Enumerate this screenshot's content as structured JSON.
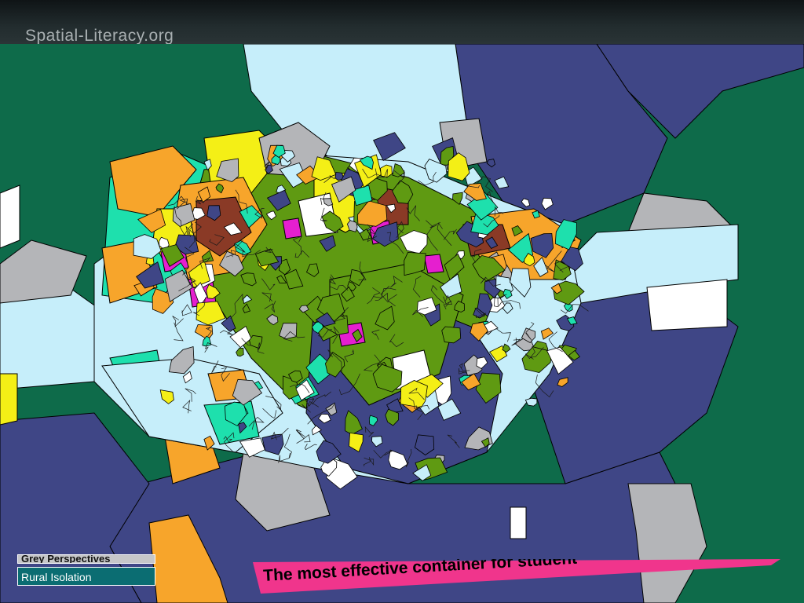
{
  "header": {
    "site_name": "Spatial-Literacy.org"
  },
  "colors": {
    "rural_green": "#0e6b4a",
    "navy": "#3f4686",
    "light_blue": "#c6eefa",
    "grey": "#b4b5b8",
    "white": "#ffffff",
    "olive_green": "#5f9a12",
    "aqua": "#1ee0ad",
    "orange": "#f7a52b",
    "yellow": "#f4ef16",
    "brown": "#8a3a26",
    "magenta": "#e51fcf",
    "banner_pink": "#f0358c"
  },
  "legend": {
    "items": [
      {
        "label": "Grey Perspectives",
        "color": "#c6c7c9"
      },
      {
        "label": "Rural Isolation",
        "color": "#0b6d72"
      }
    ]
  },
  "banner": {
    "text": "The most effective container for student"
  },
  "map": {
    "region": "urban-area-classification"
  }
}
